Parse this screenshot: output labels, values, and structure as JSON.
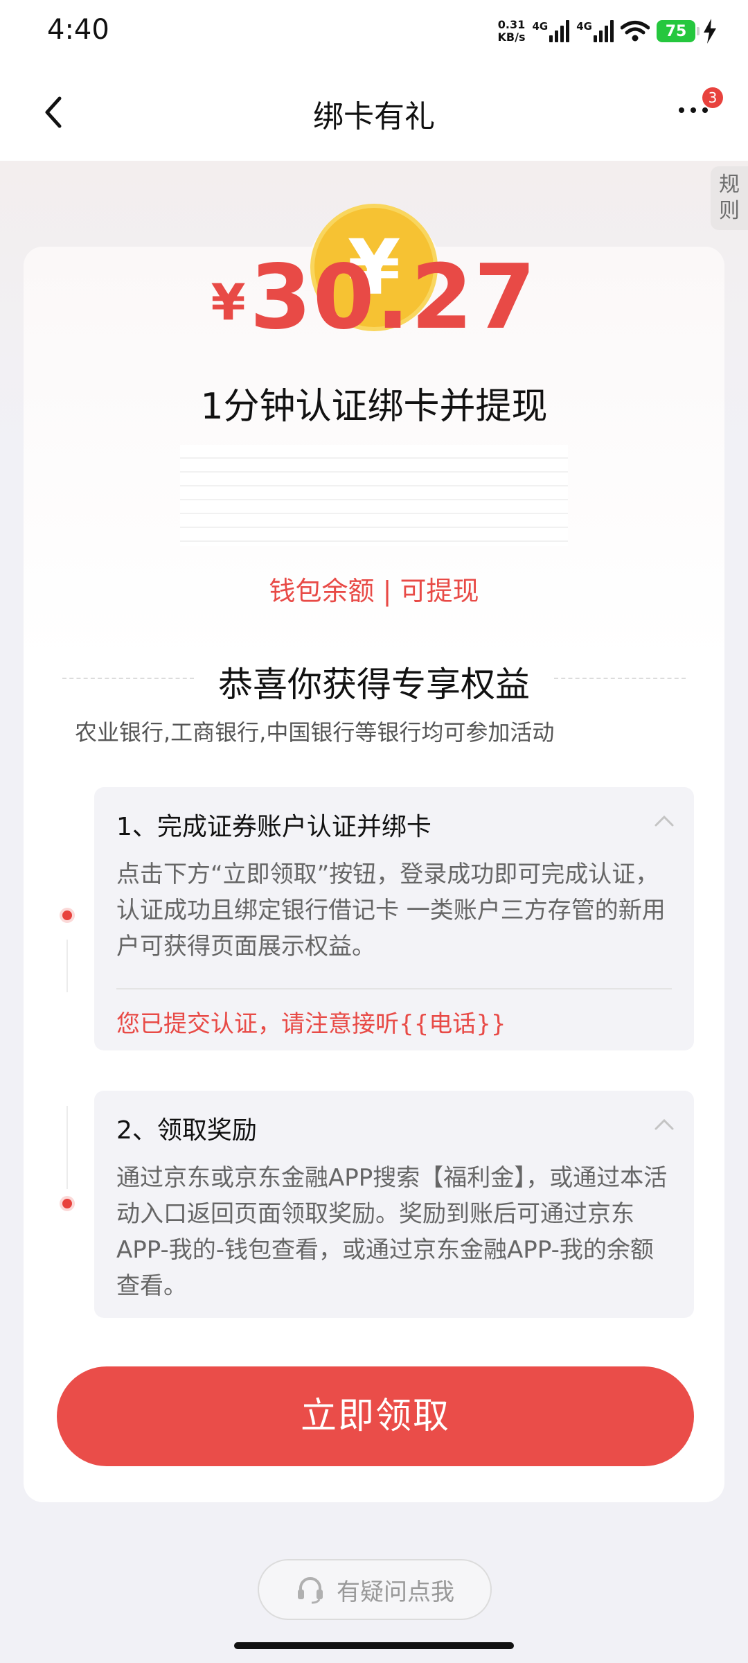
{
  "status_bar": {
    "time": "4:40",
    "net_speed_value": "0.31",
    "net_speed_unit": "KB/s",
    "sim1": "4G",
    "sim2": "4G",
    "battery": "75"
  },
  "nav": {
    "title": "绑卡有礼",
    "badge": "3"
  },
  "rules_tab": "规\n则",
  "hero": {
    "coin_symbol": "¥",
    "headline": "1分钟认证绑卡并提现",
    "amount_symbol": "¥",
    "amount": "30.27",
    "balance": "钱包余额 | 可提现"
  },
  "benefits": {
    "title": "恭喜你获得专享权益",
    "banks": "农业银行,工商银行,中国银行等银行均可参加活动"
  },
  "steps": [
    {
      "title": "1、完成证券账户认证并绑卡",
      "desc": "点击下方“立即领取”按钮，登录成功即可完成认证，认证成功且绑定银行借记卡 一类账户三方存管的新用户可获得页面展示权益。",
      "notice": "您已提交认证，请注意接听{{电话}}"
    },
    {
      "title": "2、领取奖励",
      "desc": "通过京东或京东金融APP搜索【福利金】，或通过本活动入口返回页面领取奖励。奖励到账后可通过京东APP-我的-钱包查看，或通过京东金融APP-我的余额查看。"
    }
  ],
  "claim_button": "立即领取",
  "help_button": "有疑问点我",
  "colors": {
    "accent": "#e84a46",
    "coin": "#f6c233",
    "button": "#ea4d49"
  }
}
